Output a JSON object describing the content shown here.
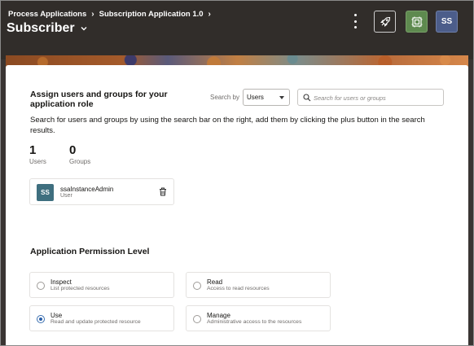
{
  "header": {
    "breadcrumb": [
      "Process Applications",
      "Subscription Application 1.0"
    ],
    "title": "Subscriber",
    "user_initials": "SS",
    "colors": {
      "background": "#312d2a",
      "grid_button": "#5e8a4f",
      "avatar": "#4c5d8a"
    },
    "icons": [
      "kebab-menu-icon",
      "rocket-launch-icon",
      "app-grid-icon"
    ]
  },
  "assign": {
    "title": "Assign users and groups for your application role",
    "search_by_label": "Search by",
    "search_by_value": "Users",
    "search_placeholder": "Search for users or groups",
    "description": "Search for users and groups by using the search bar on the right, add them by clicking the plus button in the search results.",
    "users_count": "1",
    "users_label": "Users",
    "groups_count": "0",
    "groups_label": "Groups"
  },
  "members": [
    {
      "initials": "SS",
      "name": "ssaInstanceAdmin",
      "type": "User",
      "avatar_color": "#3f6f7f"
    }
  ],
  "permissions": {
    "title": "Application Permission Level",
    "selected": "Use",
    "options": [
      {
        "label": "Inspect",
        "description": "List protected resources"
      },
      {
        "label": "Read",
        "description": "Access to read resources"
      },
      {
        "label": "Use",
        "description": "Read and update protected resource"
      },
      {
        "label": "Manage",
        "description": "Administrative access to the resources"
      }
    ]
  }
}
